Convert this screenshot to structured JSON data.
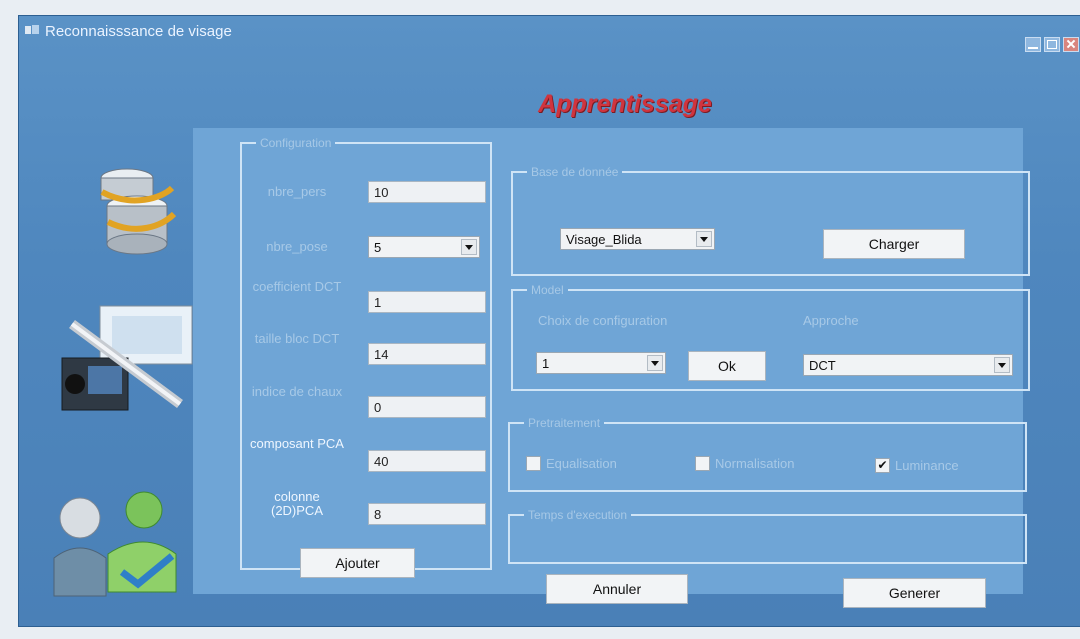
{
  "window": {
    "title": "Reconnaisssance de visage",
    "heading": "Apprentissage"
  },
  "configuration": {
    "legend": "Configuration",
    "fields": [
      {
        "label": "nbre_pers",
        "value": "10"
      },
      {
        "label": "nbre_pose",
        "value": "5"
      },
      {
        "label": "coefficient DCT",
        "value": "1"
      },
      {
        "label": "taille bloc DCT",
        "value": "14"
      },
      {
        "label": "indice de chaux",
        "value": "0"
      },
      {
        "label": "composant PCA",
        "value": "40"
      },
      {
        "label": "colonne (2D)PCA",
        "value": "8"
      }
    ],
    "add_button": "Ajouter"
  },
  "base": {
    "legend": "Base de donnée",
    "selected": "Visage_Blida",
    "load_button": "Charger"
  },
  "model": {
    "legend": "Model",
    "config_label": "Choix de configuration",
    "config_selected": "1",
    "ok_button": "Ok",
    "approach_label": "Approche",
    "approach_selected": "DCT"
  },
  "preprocessing": {
    "legend": "Pretraitement",
    "options": [
      {
        "label": "Equalisation",
        "checked": false
      },
      {
        "label": "Normalisation",
        "checked": false
      },
      {
        "label": "Luminance",
        "checked": true
      }
    ],
    "checkmark": "✔"
  },
  "execution": {
    "legend": "Temps d'execution"
  },
  "buttons": {
    "cancel": "Annuler",
    "generate": "Generer"
  },
  "icons": [
    "database-icon",
    "camera-pen-icon",
    "users-check-icon"
  ]
}
